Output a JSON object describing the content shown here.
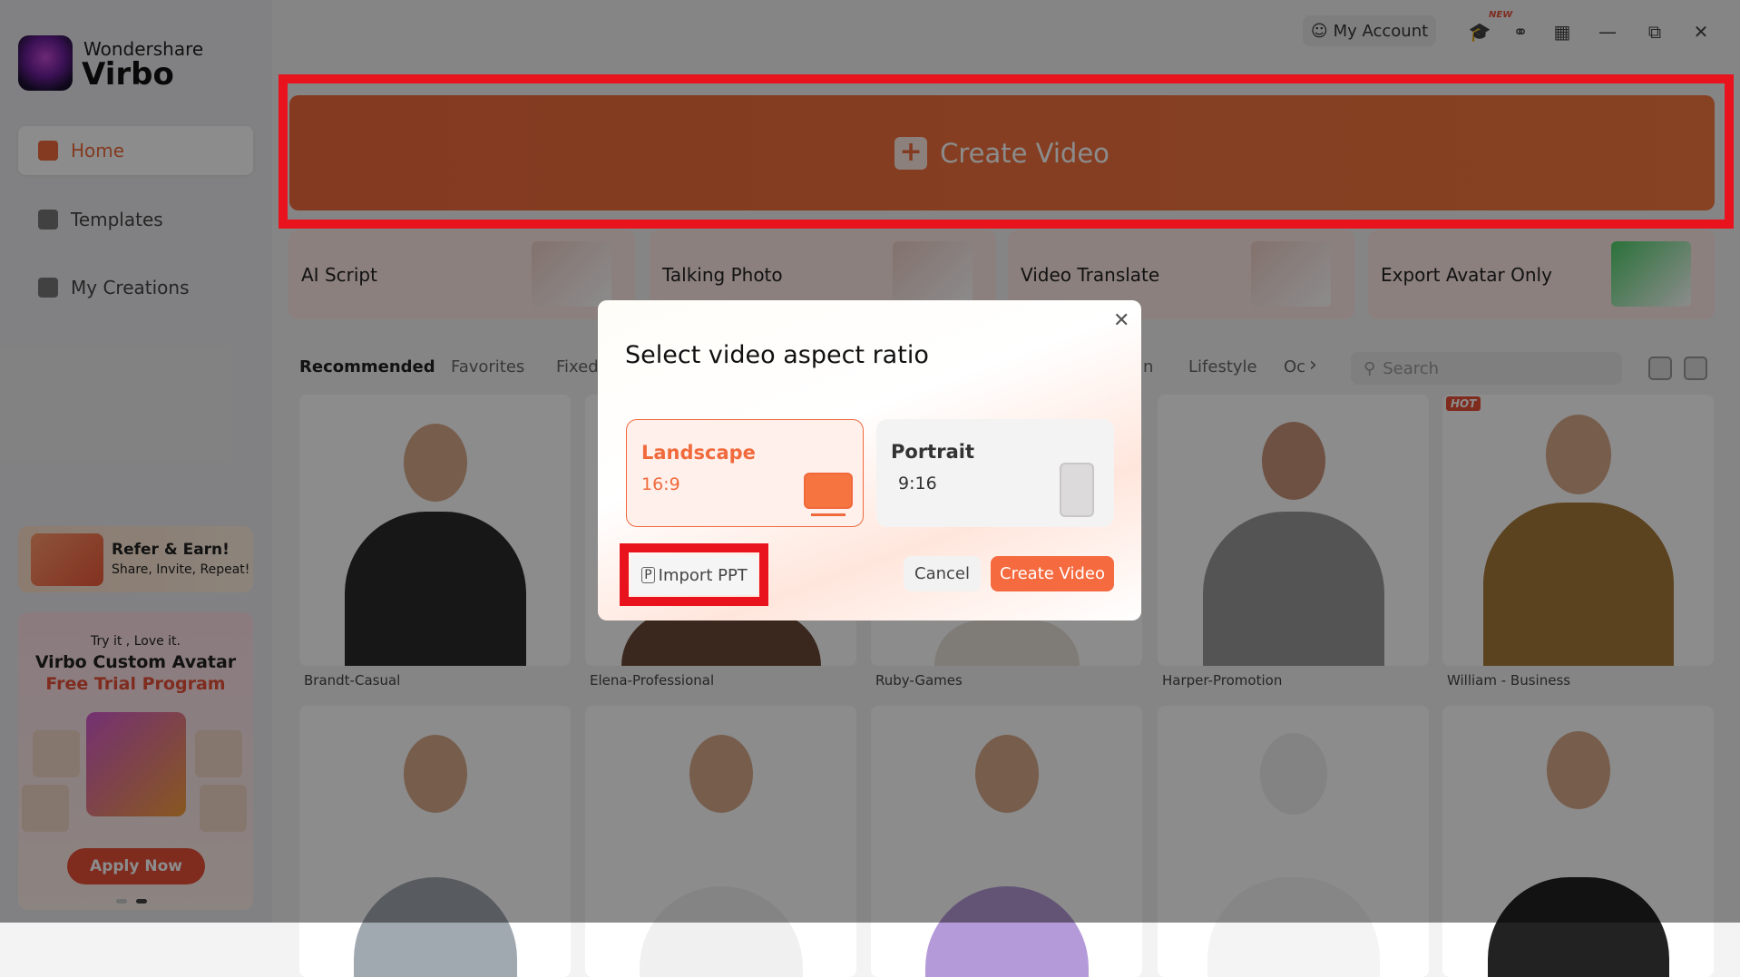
{
  "app": {
    "brand_line1": "Wondershare",
    "brand_line2": "Virbo"
  },
  "sidebar": {
    "items": [
      {
        "label": "Home",
        "active": true
      },
      {
        "label": "Templates"
      },
      {
        "label": "My Creations"
      }
    ],
    "refer": {
      "title": "Refer & Earn!",
      "subtitle": "Share, Invite, Repeat!"
    },
    "promo": {
      "line1": "Try it , Love it.",
      "line2": "Virbo Custom Avatar",
      "line3": "Free Trial Program",
      "button": "Apply Now"
    }
  },
  "topbar": {
    "account": "My Account",
    "new_badge": "NEW",
    "icons": [
      "graduation-cap-icon",
      "headset-icon",
      "grid-icon",
      "minimize-icon",
      "restore-icon",
      "close-icon"
    ]
  },
  "main": {
    "create_video": "Create Video",
    "features": [
      "AI Script",
      "Talking Photo",
      "Video Translate",
      "Export Avatar Only"
    ],
    "tabs": [
      "Recommended",
      "Favorites",
      "Fixed",
      "n",
      "Lifestyle",
      "Oc"
    ],
    "search_placeholder": "Search",
    "avatars": [
      {
        "name": "Brandt-Casual"
      },
      {
        "name": "Elena-Professional"
      },
      {
        "name": "Ruby-Games"
      },
      {
        "name": "Harper-Promotion"
      },
      {
        "name": "William - Business",
        "badge": "HOT"
      }
    ]
  },
  "modal": {
    "title": "Select video aspect ratio",
    "options": [
      {
        "name": "Landscape",
        "ratio": "16:9",
        "selected": true
      },
      {
        "name": "Portrait",
        "ratio": "9:16",
        "selected": false
      }
    ],
    "import": "Import PPT",
    "cancel": "Cancel",
    "create": "Create Video"
  },
  "colors": {
    "accent": "#f06a3c",
    "highlight": "#e8131c"
  }
}
